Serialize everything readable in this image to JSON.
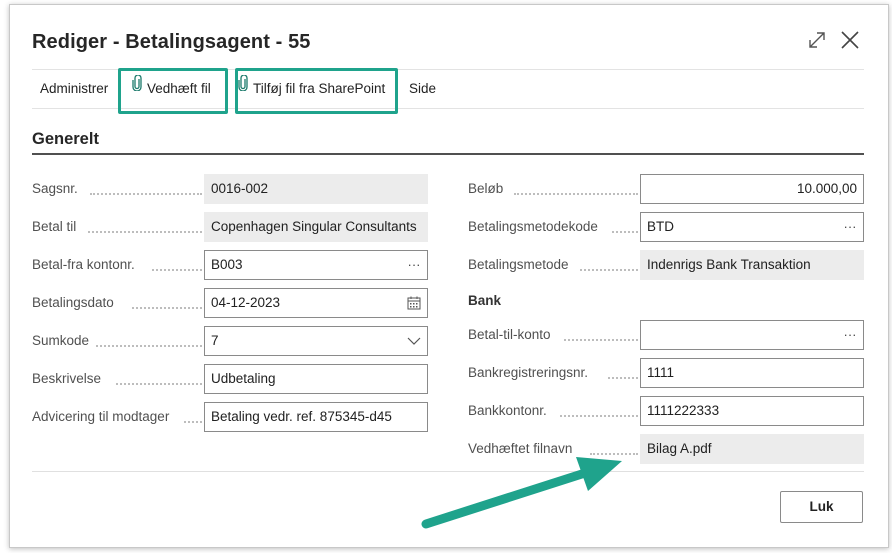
{
  "window": {
    "title": "Rediger - Betalingsagent - 55"
  },
  "actions": {
    "administrer": "Administrer",
    "vedhaeft_fil": "Vedhæft fil",
    "tilfoej_sharepoint": "Tilføj fil fra SharePoint",
    "side": "Side"
  },
  "section": {
    "title": "Generelt"
  },
  "left_fields": [
    {
      "label": "Sagsnr.",
      "value": "0016-002"
    },
    {
      "label": "Betal til",
      "value": "Copenhagen Singular Consultants"
    },
    {
      "label": "Betal-fra kontonr.",
      "value": "B003"
    },
    {
      "label": "Betalingsdato",
      "value": "04-12-2023"
    },
    {
      "label": "Sumkode",
      "value": "7"
    },
    {
      "label": "Beskrivelse",
      "value": "Udbetaling"
    },
    {
      "label": "Advicering til modtager",
      "value": "Betaling vedr. ref. 875345-d45"
    }
  ],
  "right_fields": [
    {
      "label": "Beløb",
      "value": "10.000,00"
    },
    {
      "label": "Betalingsmetodekode",
      "value": "BTD"
    },
    {
      "label": "Betalingsmetode",
      "value": "Indenrigs Bank Transaktion"
    }
  ],
  "bank": {
    "heading": "Bank",
    "fields": [
      {
        "label": "Betal-til-konto",
        "value": ""
      },
      {
        "label": "Bankregistreringsnr.",
        "value": "1111"
      },
      {
        "label": "Bankkontonr.",
        "value": "1111222333"
      },
      {
        "label": "Vedhæftet filnavn",
        "value": "Bilag A.pdf"
      }
    ]
  },
  "footer": {
    "close_label": "Luk"
  },
  "icons": {
    "expand": "expand-icon",
    "close": "close-icon",
    "attach": "paperclip-icon",
    "lookup": "ellipsis-icon",
    "calendar": "calendar-icon",
    "dropdown": "chevron-down-icon"
  },
  "colors": {
    "highlight": "#1fa38c",
    "arrow": "#1fa38c",
    "readonly_bg": "#ececec",
    "field_border": "#8a8a8a"
  }
}
